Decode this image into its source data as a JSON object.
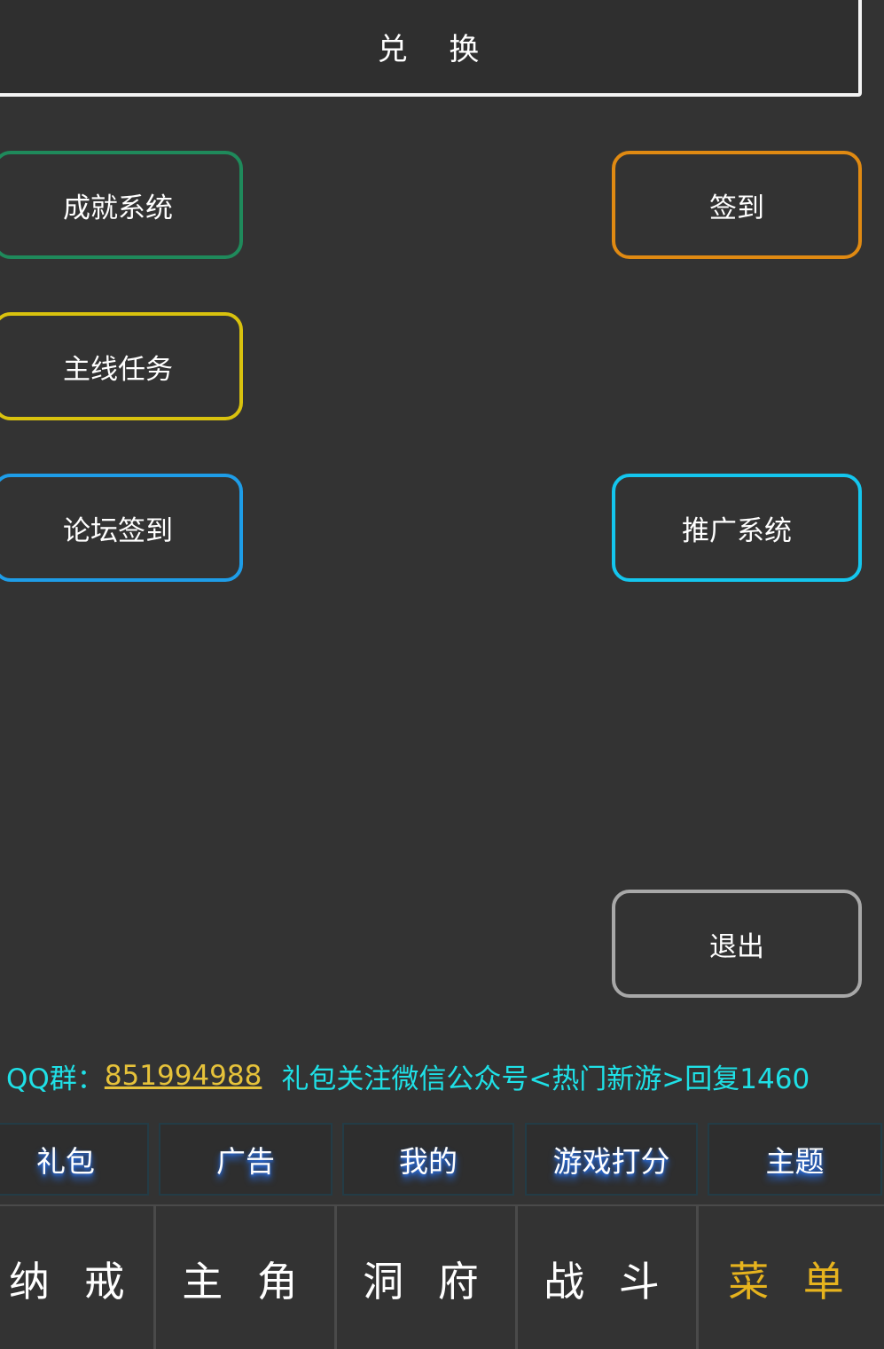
{
  "redeem": {
    "label": "兑 换"
  },
  "buttons": {
    "achievement": "成就系统",
    "signin": "签到",
    "main_quest": "主线任务",
    "forum_signin": "论坛签到",
    "promotion": "推广系统",
    "exit": "退出"
  },
  "notice": {
    "qq_prefix": "QQ群：",
    "qq_number": "851994988",
    "gift_text": "礼包关注微信公众号<热门新游>回复1460"
  },
  "subtabs": [
    "礼包",
    "广告",
    "我的",
    "游戏打分",
    "主题"
  ],
  "nav": {
    "items": [
      "纳 戒",
      "主 角",
      "洞 府",
      "战 斗",
      "菜 单"
    ],
    "active_index": 4
  },
  "colors": {
    "background": "#333333",
    "achievement_border": "#1f8a5b",
    "signin_border": "#e08a12",
    "main_quest_border": "#d9c20e",
    "forum_border": "#1e9de8",
    "promotion_border": "#14c6ee",
    "exit_border": "#a8a8a8",
    "notice_text": "#1fe0e6",
    "qq_number": "#e6c23a",
    "active_nav": "#e6b31e"
  }
}
